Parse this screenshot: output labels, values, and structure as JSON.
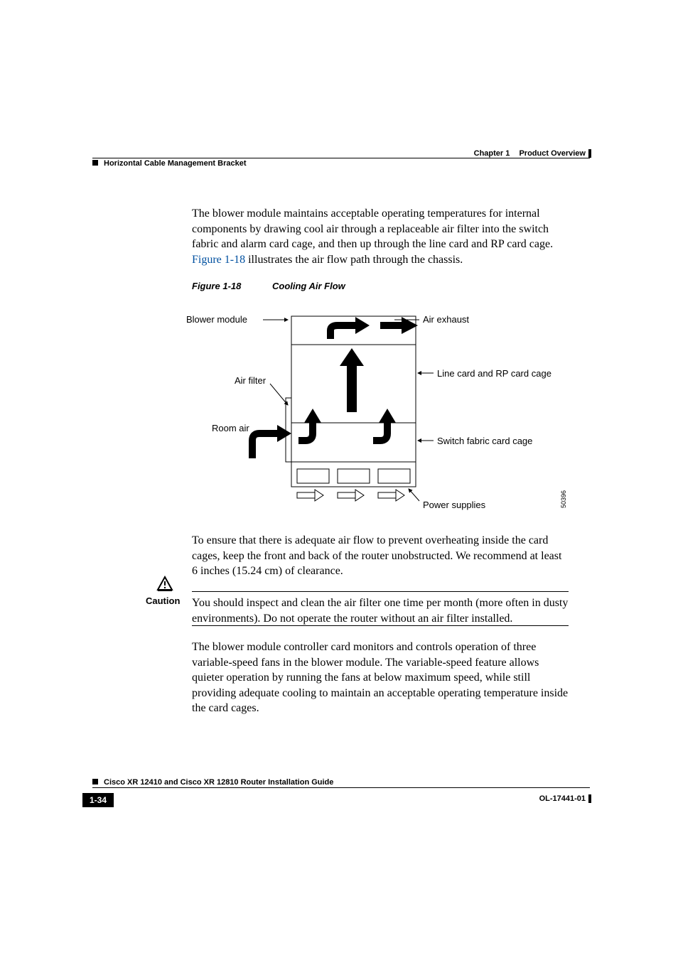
{
  "header": {
    "chapter_label": "Chapter 1",
    "chapter_title": "Product Overview",
    "section_title": "Horizontal Cable Management Bracket"
  },
  "paragraphs": {
    "p1_a": "The blower module maintains acceptable operating temperatures for internal components by drawing cool air through a replaceable air filter into the switch fabric and alarm card cage, and then up through the line card and RP card cage. ",
    "p1_link": "Figure 1-18",
    "p1_b": " illustrates the air flow path through the chassis.",
    "p2": "To ensure that there is adequate air flow to prevent overheating inside the card cages, keep the front and back of the router unobstructed. We recommend at least 6 inches (15.24 cm) of clearance.",
    "p3": "The blower module controller card monitors and controls operation of three variable-speed fans in the blower module. The variable-speed feature allows quieter operation by running the fans at below maximum speed, while still providing adequate cooling to maintain an acceptable operating temperature inside the card cages."
  },
  "figure": {
    "number": "Figure 1-18",
    "title": "Cooling Air Flow",
    "labels": {
      "blower": "Blower module",
      "exhaust": "Air exhaust",
      "filter": "Air filter",
      "linecard": "Line card and RP card cage",
      "room": "Room air",
      "switchfabric": "Switch fabric card cage",
      "power": "Power supplies"
    },
    "id": "50396"
  },
  "caution": {
    "label": "Caution",
    "text": "You should inspect and clean the air filter one time per month (more often in dusty environments). Do not operate the router without an air filter installed."
  },
  "footer": {
    "guide_title": "Cisco XR 12410 and Cisco XR 12810 Router Installation Guide",
    "page_number": "1-34",
    "doc_id": "OL-17441-01"
  }
}
